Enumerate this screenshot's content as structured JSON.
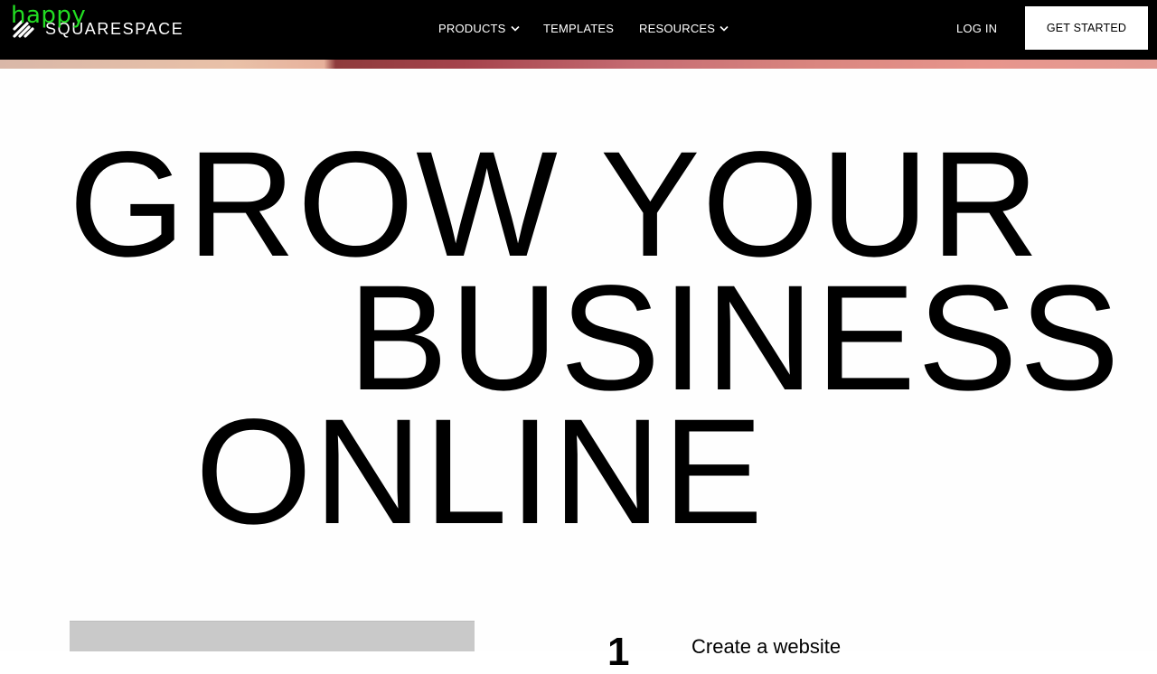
{
  "watermark": {
    "text": "happy"
  },
  "header": {
    "logo_text": "SQUARESPACE",
    "logo_icon": "squarespace-logo-icon",
    "nav": [
      {
        "label": "PRODUCTS",
        "has_dropdown": true
      },
      {
        "label": "TEMPLATES",
        "has_dropdown": false
      },
      {
        "label": "RESOURCES",
        "has_dropdown": true
      }
    ],
    "login_label": "LOG IN",
    "cta_label": "GET STARTED"
  },
  "hero": {
    "lines": [
      "GROW YOUR",
      "BUSINESS",
      "ONLINE"
    ]
  },
  "steps": {
    "number": "1",
    "title": "Create a website"
  },
  "colors": {
    "header_bg": "#000000",
    "page_bg": "#ffffff",
    "watermark": "#22dd22",
    "placeholder": "#c9c9c9"
  }
}
